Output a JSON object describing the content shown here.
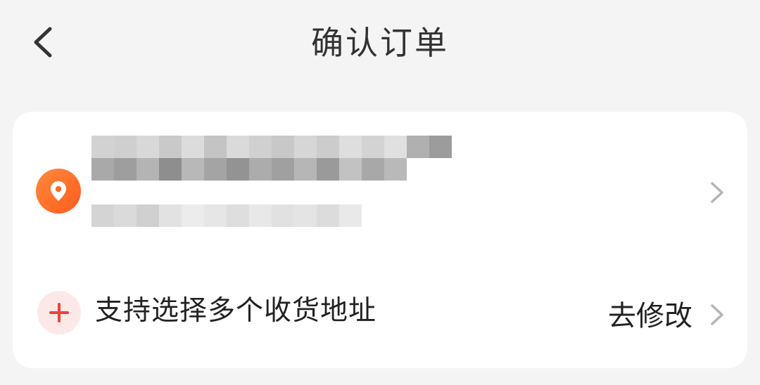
{
  "header": {
    "title": "确认订单",
    "back_icon": "chevron-left-icon"
  },
  "address_card": {
    "location_icon": "location-pin-icon",
    "accent_color": "#ff6a26",
    "address_blurred": true,
    "chevron_icon": "chevron-right-icon"
  },
  "multi_address": {
    "icon": "plus-icon",
    "label": "支持选择多个收货地址",
    "action_label": "去修改",
    "chevron_icon": "chevron-right-icon",
    "icon_color": "#e8453c"
  }
}
